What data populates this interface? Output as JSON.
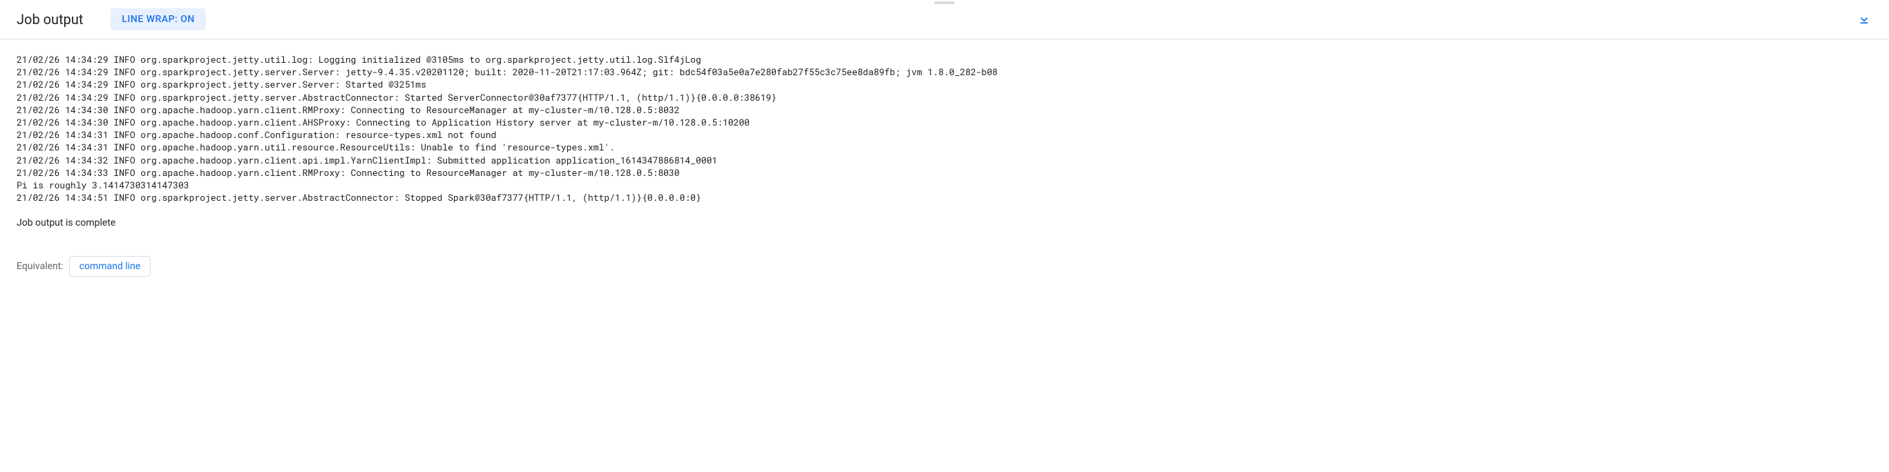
{
  "header": {
    "title": "Job output",
    "line_wrap_label": "LINE WRAP: ON"
  },
  "log_lines": [
    "21/02/26 14:34:29 INFO org.sparkproject.jetty.util.log: Logging initialized @3105ms to org.sparkproject.jetty.util.log.Slf4jLog",
    "21/02/26 14:34:29 INFO org.sparkproject.jetty.server.Server: jetty-9.4.35.v20201120; built: 2020-11-20T21:17:03.964Z; git: bdc54f03a5e0a7e280fab27f55c3c75ee8da89fb; jvm 1.8.0_282-b08",
    "21/02/26 14:34:29 INFO org.sparkproject.jetty.server.Server: Started @3251ms",
    "21/02/26 14:34:29 INFO org.sparkproject.jetty.server.AbstractConnector: Started ServerConnector@30af7377{HTTP/1.1, (http/1.1)}{0.0.0.0:38619}",
    "21/02/26 14:34:30 INFO org.apache.hadoop.yarn.client.RMProxy: Connecting to ResourceManager at my-cluster-m/10.128.0.5:8032",
    "21/02/26 14:34:30 INFO org.apache.hadoop.yarn.client.AHSProxy: Connecting to Application History server at my-cluster-m/10.128.0.5:10200",
    "21/02/26 14:34:31 INFO org.apache.hadoop.conf.Configuration: resource-types.xml not found",
    "21/02/26 14:34:31 INFO org.apache.hadoop.yarn.util.resource.ResourceUtils: Unable to find 'resource-types.xml'.",
    "21/02/26 14:34:32 INFO org.apache.hadoop.yarn.client.api.impl.YarnClientImpl: Submitted application application_1614347886814_0001",
    "21/02/26 14:34:33 INFO org.apache.hadoop.yarn.client.RMProxy: Connecting to ResourceManager at my-cluster-m/10.128.0.5:8030",
    "Pi is roughly 3.1414730314147303",
    "21/02/26 14:34:51 INFO org.sparkproject.jetty.server.AbstractConnector: Stopped Spark@30af7377{HTTP/1.1, (http/1.1)}{0.0.0.0:0}"
  ],
  "completion_message": "Job output is complete",
  "equivalent": {
    "label": "Equivalent:",
    "button": "command line"
  }
}
